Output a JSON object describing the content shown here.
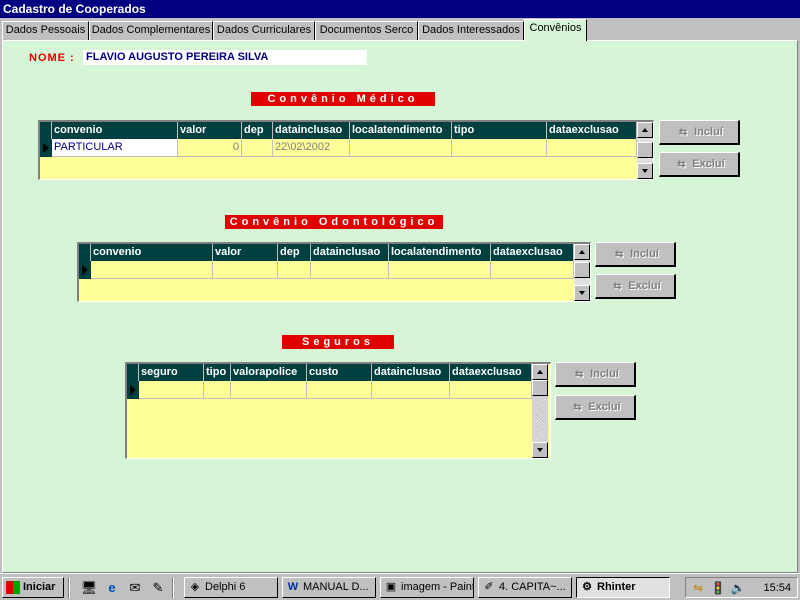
{
  "window": {
    "title": "Cadastro de Cooperados"
  },
  "tabs": [
    {
      "label": "Dados Pessoais",
      "active": false
    },
    {
      "label": "Dados Complementares",
      "active": false
    },
    {
      "label": "Dados Curriculares",
      "active": false
    },
    {
      "label": "Documentos Serco",
      "active": false
    },
    {
      "label": "Dados Interessados",
      "active": false
    },
    {
      "label": "Convênios",
      "active": true
    }
  ],
  "nome": {
    "label": "NOME :",
    "value": "FLAVIO AUGUSTO PEREIRA SILVA"
  },
  "medico": {
    "title": "Convênio Médico",
    "columns": [
      "convenio",
      "valor",
      "dep",
      "datainclusao",
      "localatendimento",
      "tipo",
      "dataexclusao"
    ],
    "rows": [
      {
        "convenio": "PARTICULAR",
        "valor": "0",
        "dep": "",
        "datainclusao": "22\\02\\2002",
        "localatendimento": "",
        "tipo": "",
        "dataexclusao": ""
      }
    ],
    "buttons": {
      "incluir": "Incluí",
      "excluir": "Excluí"
    }
  },
  "odonto": {
    "title": "Convênio Odontológico",
    "columns": [
      "convenio",
      "valor",
      "dep",
      "datainclusao",
      "localatendimento",
      "dataexclusao"
    ],
    "buttons": {
      "incluir": "Incluí",
      "excluir": "Excluí"
    }
  },
  "seguros": {
    "title": "Seguros",
    "columns": [
      "seguro",
      "tipo",
      "valorapolice",
      "custo",
      "datainclusao",
      "dataexclusao"
    ],
    "buttons": {
      "incluir": "Incluí",
      "excluir": "Excluí"
    }
  },
  "taskbar": {
    "start": "Iniciar",
    "tasks": [
      {
        "label": "Delphi 6",
        "icon": "delphi-icon"
      },
      {
        "label": "MANUAL D...",
        "icon": "word-doc-icon"
      },
      {
        "label": "imagem - Paint",
        "icon": "paint-icon"
      },
      {
        "label": "4. CAPITA~...",
        "icon": "shortcut-icon"
      },
      {
        "label": "Rhinter",
        "icon": "app-icon"
      }
    ],
    "clock": "15:54"
  },
  "colors": {
    "title_bar": "#000080",
    "form_background": "#d6f5d6",
    "section_title": "#e00000",
    "grid_background": "#ffff99",
    "grid_header": "#004040"
  }
}
